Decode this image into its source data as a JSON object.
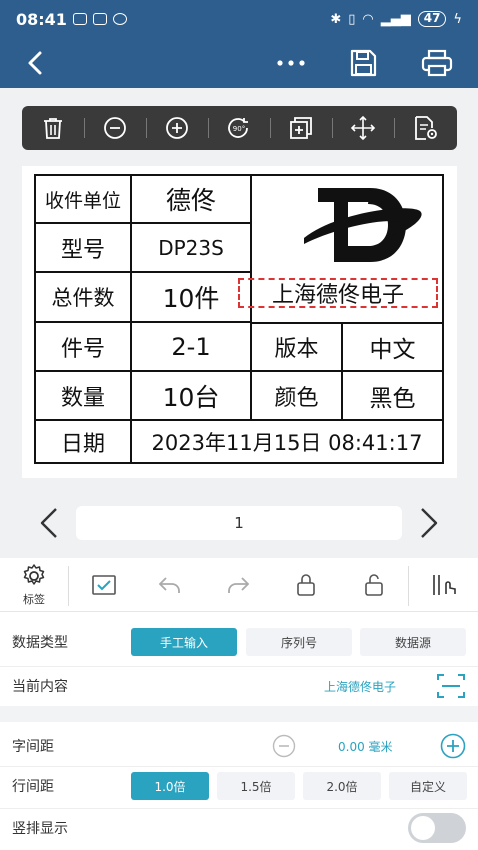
{
  "status": {
    "time": "08:41",
    "battery": "47"
  },
  "label": {
    "r1_key": "收件单位",
    "r1_val": "德佟",
    "r2_key": "型号",
    "r2_val": "DP23S",
    "r3_key": "总件数",
    "r3_val": "10件",
    "r4_key": "件号",
    "r4_val": "2-1",
    "r4_key2": "版本",
    "r4_val2": "中文",
    "r5_key": "数量",
    "r5_val": "10台",
    "r5_key2": "颜色",
    "r5_val2": "黑色",
    "r6_key": "日期",
    "r6_val": "2023年11月15日 08:41:17",
    "company": "上海德佟电子"
  },
  "pager": {
    "page": "1"
  },
  "bottom_toolbar": {
    "label_tab": "标签"
  },
  "panel": {
    "data_type_label": "数据类型",
    "data_type_options": [
      "手工输入",
      "序列号",
      "数据源"
    ],
    "current_content_label": "当前内容",
    "current_content_value": "上海德佟电子",
    "char_spacing_label": "字间距",
    "char_spacing_value": "0.00 毫米",
    "line_spacing_label": "行间距",
    "line_spacing_options": [
      "1.0倍",
      "1.5倍",
      "2.0倍",
      "自定义"
    ],
    "vertical_label": "竖排显示"
  },
  "colors": {
    "header": "#2d5e8d",
    "accent": "#2aa3c0",
    "toolbar": "#3a3a3a",
    "selection": "#d33333"
  },
  "icons": [
    "back-icon",
    "more-icon",
    "save-icon",
    "print-icon",
    "delete-icon",
    "zoom-out-icon",
    "zoom-in-icon",
    "rotate-90-icon",
    "copy-icon",
    "move-icon",
    "properties-icon",
    "gear-icon",
    "checkbox-icon",
    "undo-icon",
    "redo-icon",
    "lock-icon",
    "unlock-icon",
    "align-touch-icon",
    "scan-icon",
    "minus-icon",
    "plus-icon"
  ]
}
